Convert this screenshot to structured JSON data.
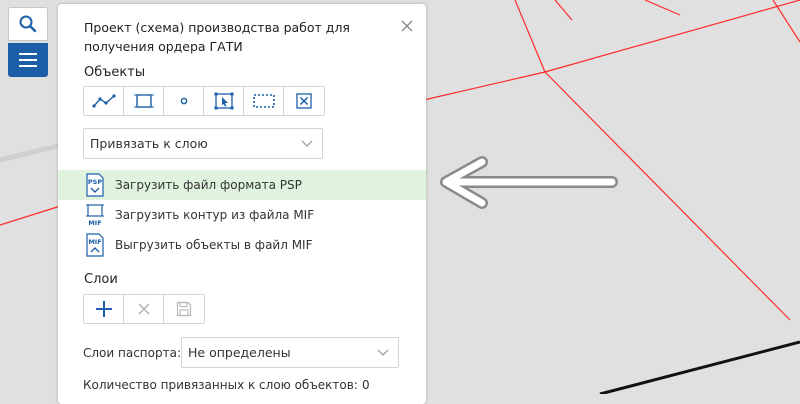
{
  "panel": {
    "title": "Проект (схема) производства работ для получения ордера ГАТИ",
    "objects_title": "Объекты",
    "bind_select": {
      "value": "Привязать к слою"
    },
    "actions": [
      {
        "label": "Загрузить файл формата PSP",
        "icon": "psp-file-icon",
        "icon_text": "PSP"
      },
      {
        "label": "Загрузить контур из файла MIF",
        "icon": "mif-contour-icon",
        "icon_text": "MIF"
      },
      {
        "label": "Выгрузить объекты в файл MIF",
        "icon": "mif-export-icon",
        "icon_text": "MIF"
      }
    ],
    "layers_title": "Слои",
    "passport_label": "Слои паспорта:",
    "passport_select": {
      "value": "Не определены"
    },
    "count_label": "Количество привязанных к слою объектов:",
    "count_value": "0"
  },
  "object_tools": [
    "polyline-tool-icon",
    "rectangle-tool-icon",
    "point-tool-icon",
    "select-tool-icon",
    "area-select-tool-icon",
    "delete-tool-icon"
  ],
  "layer_tools": [
    "add-icon",
    "remove-icon",
    "save-icon"
  ],
  "colors": {
    "accent": "#1c5fa8",
    "highlight": "#dff3df",
    "map_bg": "#e0e0e0",
    "map_lines": "#ff2b2b",
    "disabled": "#b8b8b8"
  }
}
